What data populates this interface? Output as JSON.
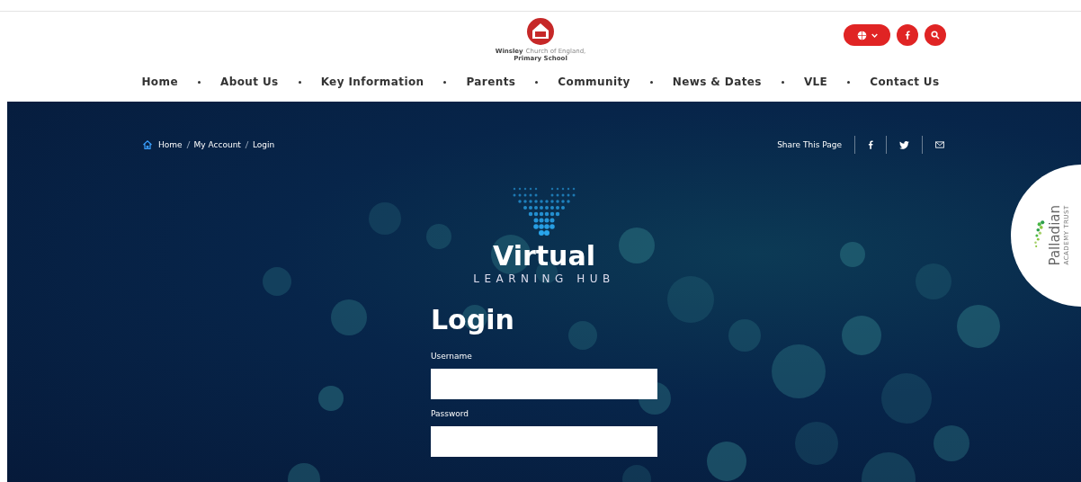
{
  "header": {
    "school_name": "Winsley",
    "school_subtitle": "Church of England,",
    "school_line2": "Primary School"
  },
  "nav": [
    {
      "label": "Home"
    },
    {
      "label": "About Us"
    },
    {
      "label": "Key Information"
    },
    {
      "label": "Parents"
    },
    {
      "label": "Community"
    },
    {
      "label": "News & Dates"
    },
    {
      "label": "VLE"
    },
    {
      "label": "Contact Us"
    }
  ],
  "breadcrumb": [
    "Home",
    "My Account",
    "Login"
  ],
  "share": {
    "label": "Share This Page"
  },
  "hub_logo": {
    "title": "Virtual",
    "subtitle": "LEARNING HUB"
  },
  "trust": {
    "name": "Palladian",
    "subtitle": "ACADEMY TRUST"
  },
  "login": {
    "heading": "Login",
    "fields": [
      {
        "label": "Username"
      },
      {
        "label": "Password"
      }
    ]
  }
}
